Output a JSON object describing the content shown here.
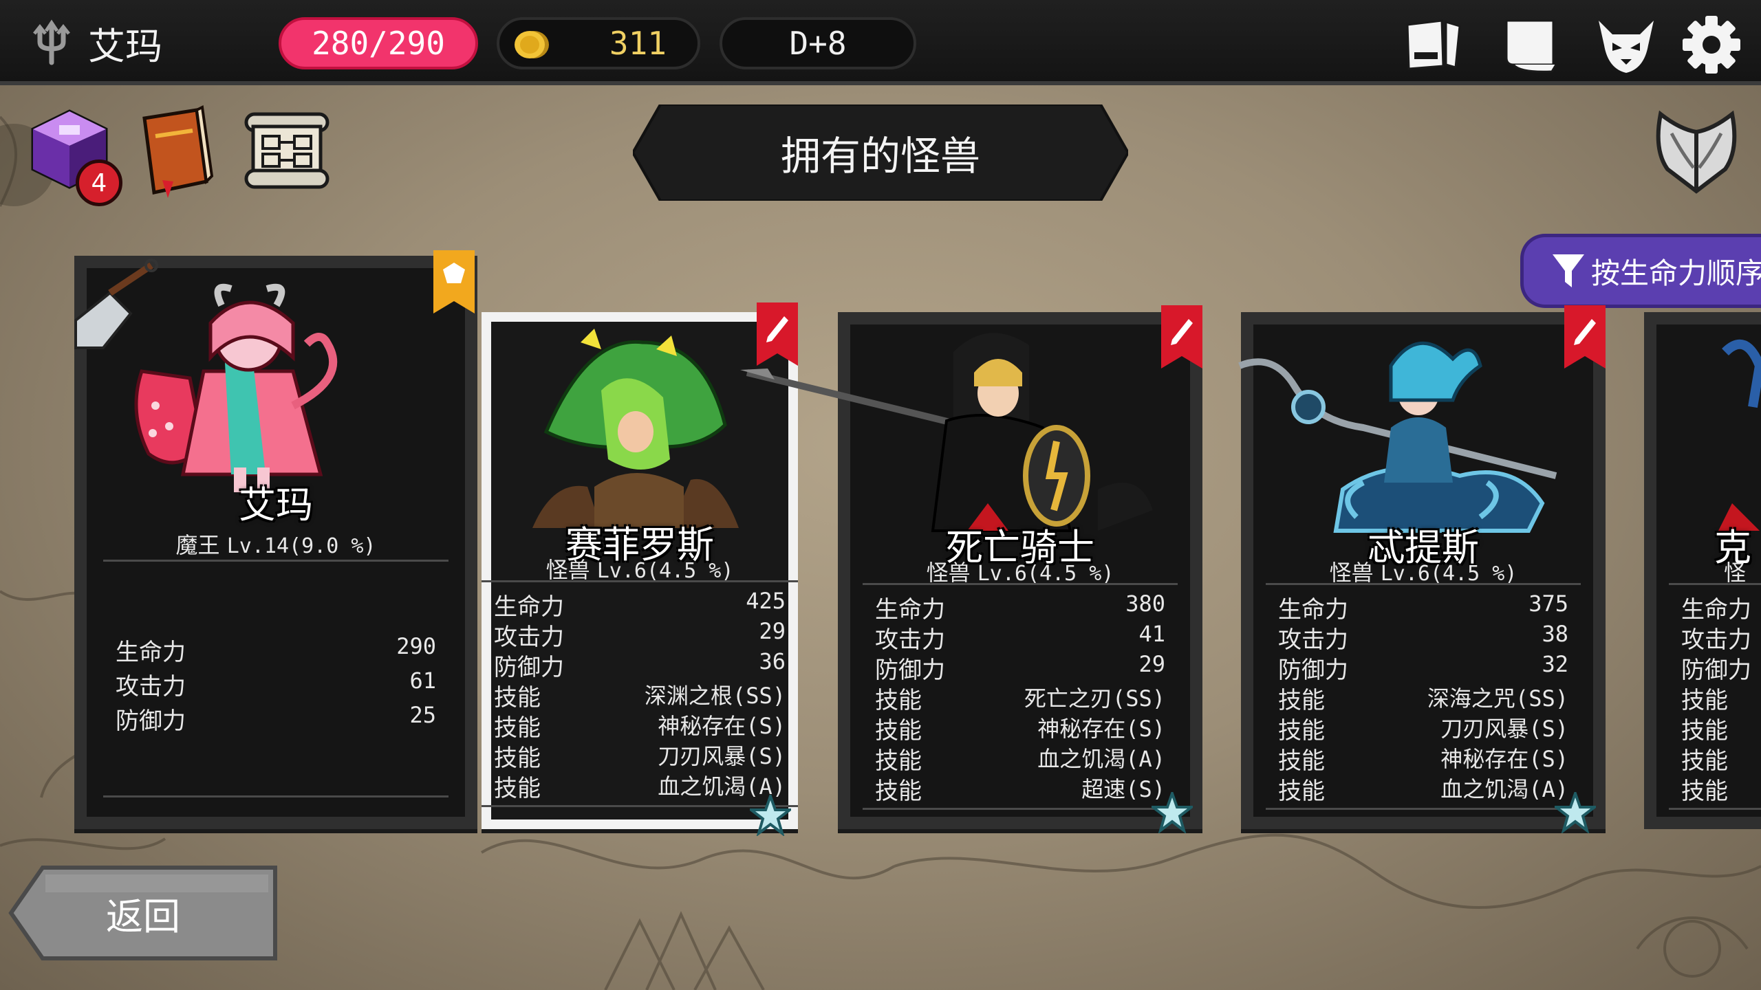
{
  "player": {
    "name": "艾玛",
    "icon": "trident-icon"
  },
  "resources": {
    "hp": "280/290",
    "gold": "311",
    "day": "D+8"
  },
  "top_icons": [
    "codex-icon",
    "scroll-icon",
    "demon-mask-icon",
    "gear-icon"
  ],
  "tools": {
    "cube_badge": "4",
    "items": [
      "magic-cube-icon",
      "spellbook-icon",
      "map-scroll-icon"
    ]
  },
  "title": "拥有的怪兽",
  "sort_button": "按生命力顺序",
  "back_button": "返回",
  "colors": {
    "hp": "#f2346c",
    "sort": "#5b3fb0",
    "ribbon": "#d8182a",
    "lord_ribbon": "#f2a81e"
  },
  "cards": [
    {
      "name": "艾玛",
      "type": "魔王",
      "level": "Lv.14(9.0 %)",
      "stats": [
        {
          "label": "生命力",
          "value": "290"
        },
        {
          "label": "攻击力",
          "value": "61"
        },
        {
          "label": "防御力",
          "value": "25"
        }
      ]
    },
    {
      "name": "赛菲罗斯",
      "type": "怪兽",
      "level": "Lv.6(4.5 %)",
      "stats": [
        {
          "label": "生命力",
          "value": "425"
        },
        {
          "label": "攻击力",
          "value": "29"
        },
        {
          "label": "防御力",
          "value": "36"
        },
        {
          "label": "技能",
          "value": "深渊之根(SS)"
        },
        {
          "label": "技能",
          "value": "神秘存在(S)"
        },
        {
          "label": "技能",
          "value": "刀刃风暴(S)"
        },
        {
          "label": "技能",
          "value": "血之饥渴(A)"
        }
      ]
    },
    {
      "name": "死亡骑士",
      "type": "怪兽",
      "level": "Lv.6(4.5 %)",
      "stats": [
        {
          "label": "生命力",
          "value": "380"
        },
        {
          "label": "攻击力",
          "value": "41"
        },
        {
          "label": "防御力",
          "value": "29"
        },
        {
          "label": "技能",
          "value": "死亡之刃(SS)"
        },
        {
          "label": "技能",
          "value": "神秘存在(S)"
        },
        {
          "label": "技能",
          "value": "血之饥渴(A)"
        },
        {
          "label": "技能",
          "value": "超速(S)"
        }
      ]
    },
    {
      "name": "忒提斯",
      "type": "怪兽",
      "level": "Lv.6(4.5 %)",
      "stats": [
        {
          "label": "生命力",
          "value": "375"
        },
        {
          "label": "攻击力",
          "value": "38"
        },
        {
          "label": "防御力",
          "value": "32"
        },
        {
          "label": "技能",
          "value": "深海之咒(SS)"
        },
        {
          "label": "技能",
          "value": "刀刃风暴(S)"
        },
        {
          "label": "技能",
          "value": "神秘存在(S)"
        },
        {
          "label": "技能",
          "value": "血之饥渴(A)"
        }
      ]
    },
    {
      "name": "克",
      "type": "怪",
      "stats": [
        {
          "label": "生命力"
        },
        {
          "label": "攻击力"
        },
        {
          "label": "防御力"
        },
        {
          "label": "技能"
        },
        {
          "label": "技能"
        },
        {
          "label": "技能"
        },
        {
          "label": "技能"
        }
      ]
    }
  ]
}
